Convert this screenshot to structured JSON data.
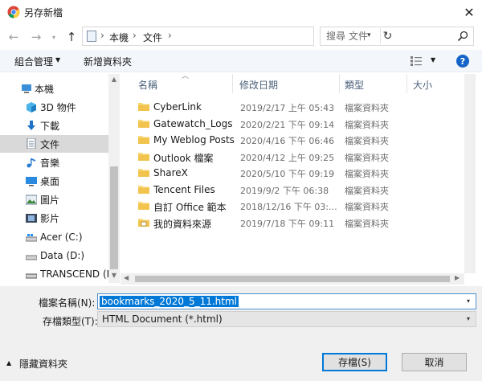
{
  "window": {
    "title": "另存新檔",
    "close_glyph": "✕"
  },
  "address": {
    "crumbs": [
      "本機",
      "文件"
    ],
    "separator": "›",
    "search_placeholder": "搜尋 文件"
  },
  "toolbar": {
    "organize_label": "組合管理",
    "new_folder_label": "新增資料夾",
    "help_label": "?"
  },
  "sidebar": {
    "items": [
      {
        "label": "本機",
        "icon": "pc-icon"
      },
      {
        "label": "3D 物件",
        "icon": "cube-icon"
      },
      {
        "label": "下載",
        "icon": "download-icon"
      },
      {
        "label": "文件",
        "icon": "document-icon",
        "selected": true
      },
      {
        "label": "音樂",
        "icon": "music-icon"
      },
      {
        "label": "桌面",
        "icon": "desktop-icon"
      },
      {
        "label": "圖片",
        "icon": "picture-icon"
      },
      {
        "label": "影片",
        "icon": "video-icon"
      },
      {
        "label": "Acer (C:)",
        "icon": "drive-icon"
      },
      {
        "label": "Data (D:)",
        "icon": "drive-icon"
      },
      {
        "label": "TRANSCEND (F",
        "icon": "usb-drive-icon"
      }
    ]
  },
  "columns": {
    "name": "名稱",
    "modified": "修改日期",
    "type": "類型",
    "size": "大小"
  },
  "files": [
    {
      "name": "CyberLink",
      "modified": "2019/2/17 上午 05:43",
      "type": "檔案資料夾",
      "icon": "folder-icon"
    },
    {
      "name": "Gatewatch_Logs",
      "modified": "2020/2/21 下午 09:14",
      "type": "檔案資料夾",
      "icon": "folder-icon"
    },
    {
      "name": "My Weblog Posts",
      "modified": "2020/4/16 下午 06:46",
      "type": "檔案資料夾",
      "icon": "folder-icon"
    },
    {
      "name": "Outlook 檔案",
      "modified": "2020/4/12 上午 09:25",
      "type": "檔案資料夾",
      "icon": "folder-icon"
    },
    {
      "name": "ShareX",
      "modified": "2020/5/10 下午 09:19",
      "type": "檔案資料夾",
      "icon": "folder-icon"
    },
    {
      "name": "Tencent Files",
      "modified": "2019/9/2 下午 06:38",
      "type": "檔案資料夾",
      "icon": "folder-icon"
    },
    {
      "name": "自訂 Office 範本",
      "modified": "2018/12/16 下午 03:...",
      "type": "檔案資料夾",
      "icon": "folder-icon"
    },
    {
      "name": "我的資料來源",
      "modified": "2019/7/18 下午 09:11",
      "type": "檔案資料夾",
      "icon": "feed-folder-icon"
    }
  ],
  "save_panel": {
    "filename_label": "檔案名稱(N):",
    "filename_value": "bookmarks_2020_5_11.html",
    "type_label": "存檔類型(T):",
    "type_value": "HTML Document (*.html)",
    "hide_folders_label": "隱藏資料夾",
    "save_label": "存檔(S)",
    "cancel_label": "取消"
  },
  "colors": {
    "accent": "#0078d7",
    "selected_bg": "#d9d9d9",
    "folder": "#f8d775",
    "help": "#1565c8"
  }
}
